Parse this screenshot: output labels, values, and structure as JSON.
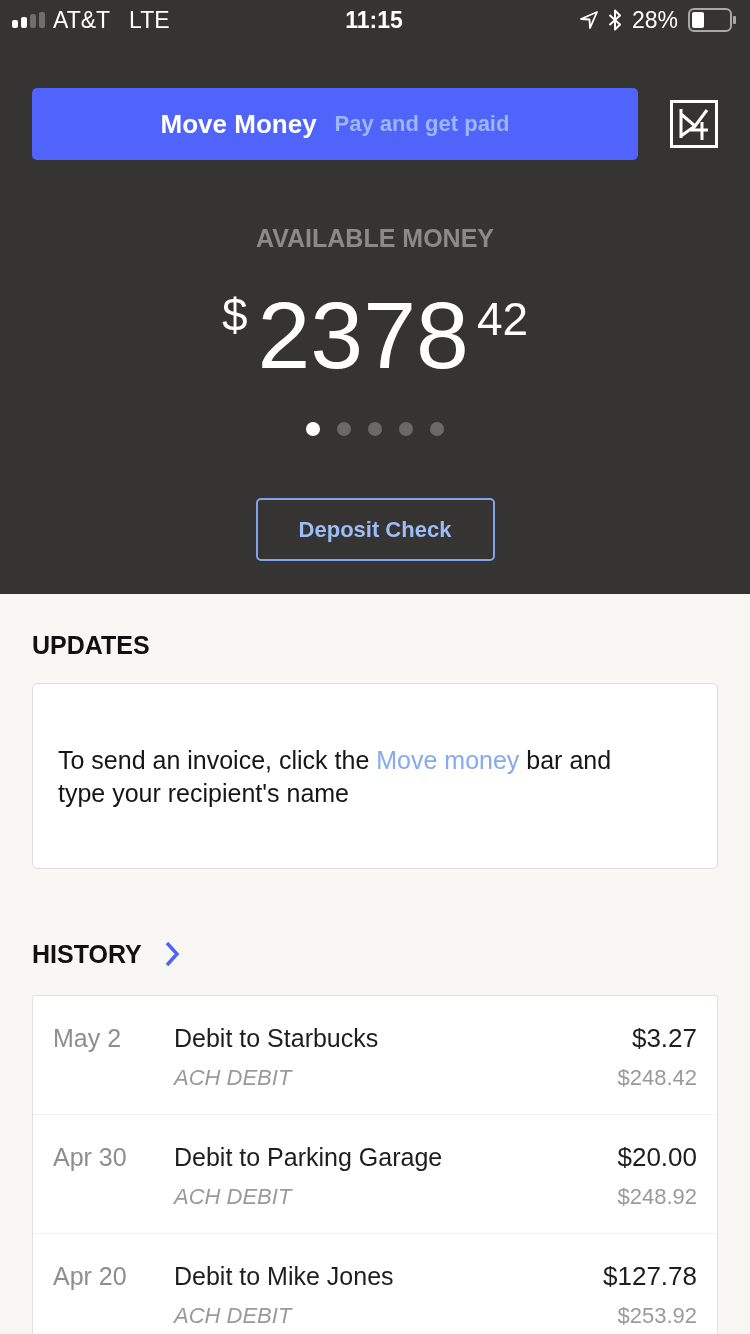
{
  "status_bar": {
    "carrier": "AT&T",
    "network": "LTE",
    "time": "11:15",
    "battery": "28%"
  },
  "header": {
    "move_money": {
      "label": "Move Money",
      "hint": "Pay and get paid"
    },
    "balance_label": "AVAILABLE MONEY",
    "balance": {
      "currency": "$",
      "dollars": "2378",
      "cents": "42"
    },
    "pages": [
      {
        "selected": true
      },
      {
        "selected": false
      },
      {
        "selected": false
      },
      {
        "selected": false
      },
      {
        "selected": false
      }
    ],
    "deposit_button": "Deposit Check"
  },
  "updates": {
    "title": "UPDATES",
    "message": {
      "before": "To send an invoice, click the ",
      "link": "Move money",
      "after": " bar and type your recipient's name"
    }
  },
  "history": {
    "title": "HISTORY",
    "rows": [
      {
        "date": "May 2",
        "description": "Debit to Starbucks",
        "type": "ACH DEBIT",
        "amount": "$3.27",
        "balance": "$248.42"
      },
      {
        "date": "Apr 30",
        "description": "Debit to Parking Garage",
        "type": "ACH DEBIT",
        "amount": "$20.00",
        "balance": "$248.92"
      },
      {
        "date": "Apr 20",
        "description": "Debit to Mike Jones",
        "type": "ACH DEBIT",
        "amount": "$127.78",
        "balance": "$253.92"
      }
    ]
  }
}
